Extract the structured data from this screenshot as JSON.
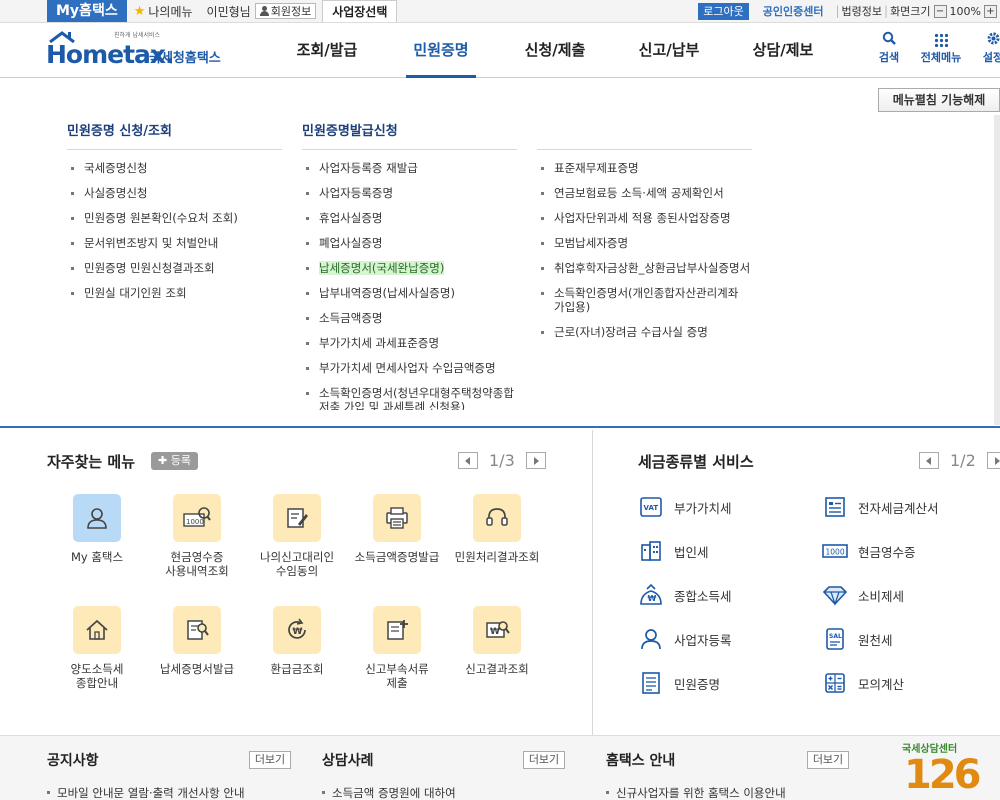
{
  "utility": {
    "my_tab": "My홈택스",
    "my_menu": "나의메뉴",
    "user_name": "이민형님",
    "member_info": "회원정보",
    "biz_select": "사업장선택",
    "logout": "로그아웃",
    "cert_center": "공인인증센터",
    "law_info": "법령정보",
    "screen_size": "화면크기",
    "zoom_minus": "−",
    "zoom_value": "100%",
    "zoom_plus": "+"
  },
  "logo": {
    "slogan": "친하게 납세서비스",
    "brand": "Hometax.",
    "kor_name": "국세청홈택스"
  },
  "gnb": [
    {
      "label": "조회/발급"
    },
    {
      "label": "민원증명"
    },
    {
      "label": "신청/제출"
    },
    {
      "label": "신고/납부"
    },
    {
      "label": "상담/제보"
    }
  ],
  "tools": {
    "search": "검색",
    "all_menu": "전체메뉴",
    "settings": "설정"
  },
  "mega": {
    "fix_button": "메뉴펼침 기능해제",
    "col1": {
      "title": "민원증명 신청/조회",
      "items": [
        "국세증명신청",
        "사실증명신청",
        "민원증명 원본확인(수요처 조회)",
        "문서위변조방지 및 처벌안내",
        "민원증명 민원신청결과조회",
        "민원실 대기인원 조회"
      ]
    },
    "col2": {
      "title": "민원증명발급신청",
      "items": [
        "사업자등록증 재발급",
        "사업자등록증명",
        "휴업사실증명",
        "폐업사실증명",
        "납세증명서(국세완납증명)",
        "납부내역증명(납세사실증명)",
        "소득금액증명",
        "부가가치세 과세표준증명",
        "부가가치세 면세사업자 수입금액증명",
        "소득확인증명서(청년우대형주택청약종합저축 가입 및 과세특례 신청용)"
      ]
    },
    "col3": {
      "items": [
        "표준재무제표증명",
        "연금보험료등 소득·세액 공제확인서",
        "사업자단위과세 적용 종된사업장증명",
        "모범납세자증명",
        "취업후학자금상환_상환금납부사실증명서",
        "소득확인증명서(개인종합자산관리계좌 가입용)",
        "근로(자녀)장려금 수급사실 증명"
      ]
    }
  },
  "quick": {
    "title": "자주찾는 메뉴",
    "register": "등록",
    "page": "1/3",
    "items": [
      {
        "label": "My 홈택스"
      },
      {
        "label": "현금영수증\n사용내역조회"
      },
      {
        "label": "나의신고대리인\n수임동의"
      },
      {
        "label": "소득금액증명발급"
      },
      {
        "label": "민원처리결과조회"
      },
      {
        "label": "양도소득세\n종합안내"
      },
      {
        "label": "납세증명서발급"
      },
      {
        "label": "환급금조회"
      },
      {
        "label": "신고부속서류\n제출"
      },
      {
        "label": "신고결과조회"
      }
    ]
  },
  "taxsvc": {
    "title": "세금종류별 서비스",
    "page": "1/2",
    "items": [
      {
        "label": "부가가치세",
        "icon": "vat-icon"
      },
      {
        "label": "전자세금계산서",
        "icon": "e-invoice-icon"
      },
      {
        "label": "법인세",
        "icon": "corporate-tax-icon"
      },
      {
        "label": "현금영수증",
        "icon": "cash-receipt-icon"
      },
      {
        "label": "종합소득세",
        "icon": "income-tax-icon"
      },
      {
        "label": "소비제세",
        "icon": "consumption-tax-icon"
      },
      {
        "label": "사업자등록",
        "icon": "business-registration-icon"
      },
      {
        "label": "원천세",
        "icon": "withholding-tax-icon"
      },
      {
        "label": "민원증명",
        "icon": "certificate-icon"
      },
      {
        "label": "모의계산",
        "icon": "calculator-icon"
      }
    ]
  },
  "bottom": {
    "notice": {
      "title": "공지사항",
      "more": "더보기",
      "first": "모바일 안내문 열람·출력 개선사항 안내"
    },
    "cases": {
      "title": "상담사례",
      "more": "더보기",
      "first": "소득금액 증명원에 대하여"
    },
    "guide": {
      "title": "홈택스 안내",
      "more": "더보기",
      "first": "신규사업자를 위한 홈택스 이용안내"
    },
    "counsel": {
      "label": "국세상담센터",
      "number": "126"
    }
  },
  "colors": {
    "brand_blue": "#1d5aa8",
    "tab_blue": "#2f6fbf",
    "highlight_green": "#d4f5cf",
    "quick_yellow": "#fdeab8",
    "quick_blue": "#b9daf7"
  }
}
